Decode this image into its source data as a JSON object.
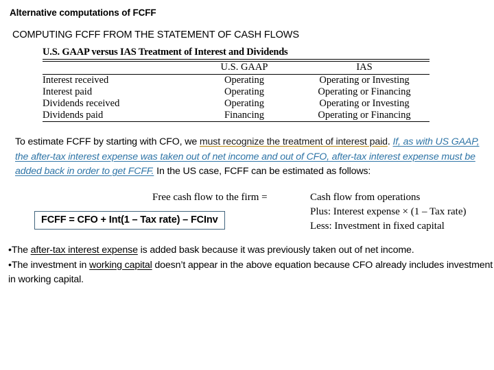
{
  "slide": {
    "heading_primary": "Alternative computations of FCFF",
    "heading_secondary": "COMPUTING FCFF FROM THE STATEMENT OF CASH FLOWS"
  },
  "table": {
    "caption": "U.S. GAAP versus IAS Treatment of Interest and Dividends",
    "columns": [
      "",
      "U.S. GAAP",
      "IAS"
    ],
    "rows": [
      {
        "item": "Interest received",
        "us_gaap": "Operating",
        "ias": "Operating or Investing"
      },
      {
        "item": "Interest paid",
        "us_gaap": "Operating",
        "ias": "Operating or Financing"
      },
      {
        "item": "Dividends received",
        "us_gaap": "Operating",
        "ias": "Operating or Investing"
      },
      {
        "item": "Dividends paid",
        "us_gaap": "Financing",
        "ias": "Operating or Financing"
      }
    ]
  },
  "paragraph": {
    "lead": "To estimate FCFF by starting with CFO, we ",
    "highlight_tan": "must recognize the treatment of interest paid",
    "after_tan": ". ",
    "highlight_blue": "If, as with US GAAP, the after-tax interest expense was taken out of net income and out of CFO, after-tax interest expense must be added back in order to get FCFF.",
    "tail": " In the US case, FCFF can be estimated as follows:"
  },
  "equation": {
    "left_label": "Free cash flow to the firm =",
    "lines": [
      "Cash flow from operations",
      "Plus: Interest expense × (1 – Tax rate)",
      "Less: Investment in fixed capital"
    ]
  },
  "formula_box": {
    "text": "FCFF = CFO + Int(1 – Tax rate) – FCInv",
    "border_color": "#41647d"
  },
  "bullets": [
    {
      "marker": "•",
      "pre": "The ",
      "underlined": "after-tax interest expense",
      "post": " is added bask because it was previously taken out of net income."
    },
    {
      "marker": "•",
      "pre": "The investment in ",
      "underlined": "working capital",
      "post": " doesn’t appear in the above equation because CFO already includes investment in working capital."
    }
  ],
  "colors": {
    "highlight_tan": "#b8860b",
    "highlight_blue": "#2e74a6",
    "text": "#000000",
    "background": "#ffffff"
  }
}
